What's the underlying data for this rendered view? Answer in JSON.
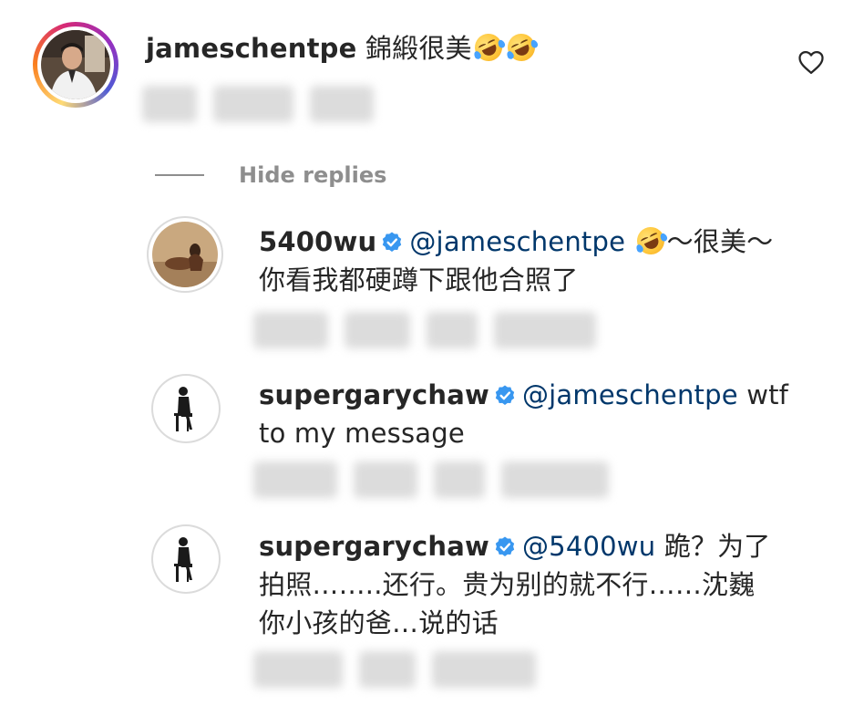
{
  "comment": {
    "username": "jameschentpe",
    "text": "錦緞很美",
    "emojis": [
      "rolling-on-floor-laughing",
      "rolling-on-floor-laughing"
    ],
    "like_icon": "heart-outline-icon"
  },
  "hide_replies_label": "Hide replies",
  "replies": [
    {
      "username": "5400wu",
      "verified": true,
      "mention": "@jameschentpe",
      "text_after_emoji": "～很美～",
      "line2": "你看我都硬蹲下跟他合照了"
    },
    {
      "username": "supergarychaw",
      "verified": true,
      "mention": "@jameschentpe",
      "line1_rest": "wtf",
      "line2": "to my message"
    },
    {
      "username": "supergarychaw",
      "verified": true,
      "mention": "@5400wu",
      "line1_rest": "跪？为了",
      "line2": "拍照……..还行。贵为别的就不行……沈巍",
      "line3": "你小孩的爸…说的话"
    }
  ],
  "colors": {
    "text": "#262626",
    "mention": "#00376b",
    "muted": "#8e8e8e",
    "verified": "#3897f0"
  }
}
